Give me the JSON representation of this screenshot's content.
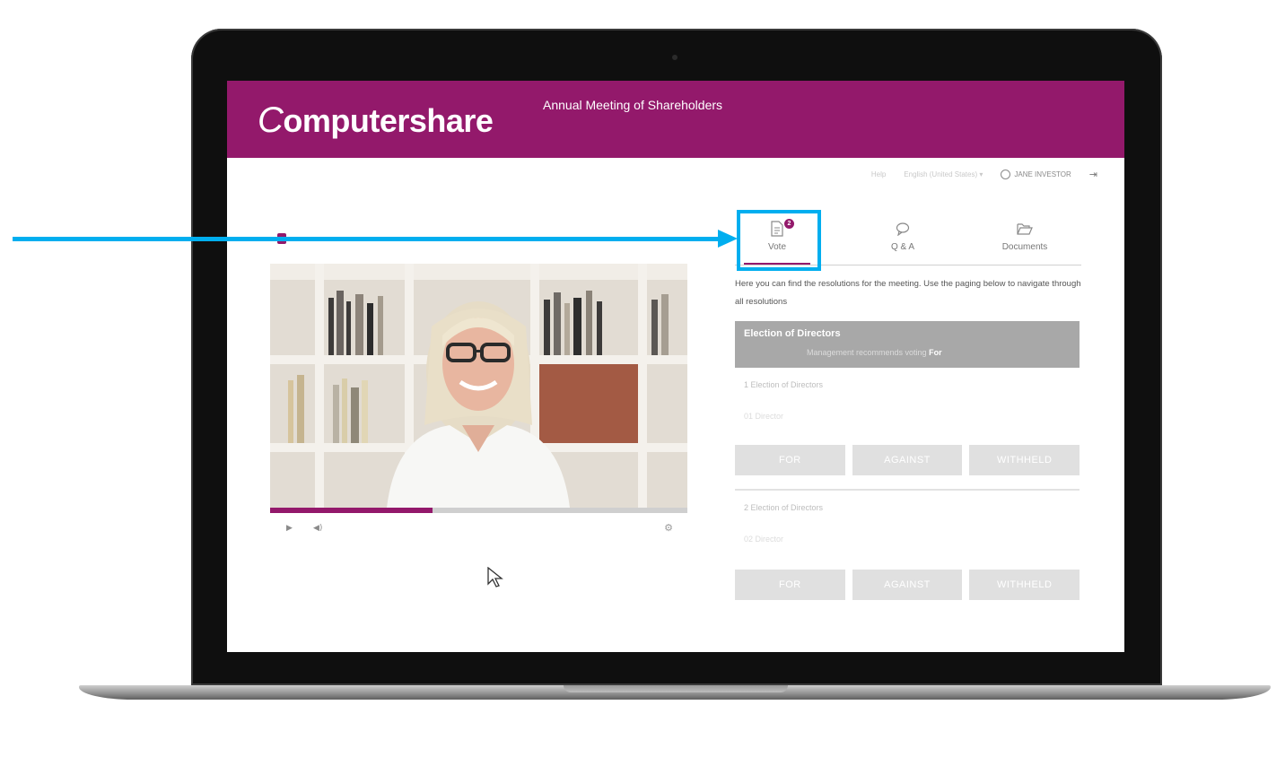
{
  "header": {
    "logo_text": "omputershare",
    "logo_c": "C",
    "meeting_title": "Annual Meeting of Shareholders"
  },
  "topbar": {
    "help": "Help",
    "language": "English (United States) ▾",
    "user_name": "JANE INVESTOR"
  },
  "video": {
    "progress_fraction": 0.39
  },
  "panel": {
    "tabs": [
      {
        "label": "Vote",
        "badge": "2"
      },
      {
        "label": "Q & A"
      },
      {
        "label": "Documents"
      }
    ],
    "instructions": "Here you can find the resolutions for the meeting. Use the paging below to navigate through all resolutions",
    "resolution": {
      "title": "Election of Directors",
      "recommendation": "Management recommends voting",
      "recommendation_value": "For"
    },
    "items": [
      {
        "title": "1 Election of Directors",
        "sub": "01 Director"
      },
      {
        "title": "2 Election of Directors",
        "sub": "02 Director"
      }
    ],
    "vote_buttons": [
      "FOR",
      "AGAINST",
      "WITHHELD"
    ]
  },
  "colors": {
    "brand": "#93196b",
    "annotation": "#00aeef"
  }
}
